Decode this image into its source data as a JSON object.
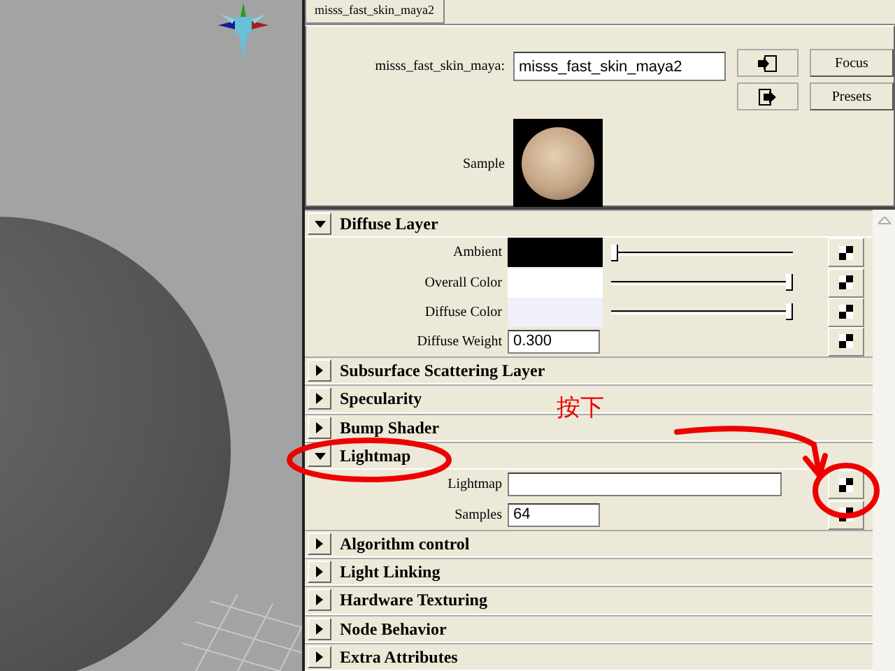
{
  "editor": {
    "tab": {
      "label": "misss_fast_skin_maya2",
      "selected": true
    },
    "name_label": "misss_fast_skin_maya:",
    "name_value": "misss_fast_skin_maya2",
    "buttons": [
      "Focus",
      "Presets"
    ],
    "sample_label": "Sample",
    "sections": [
      {
        "title": "Diffuse Layer",
        "expanded": true,
        "rows": [
          {
            "kind": "color",
            "label": "Ambient",
            "color": "#000000",
            "level": 0.0
          },
          {
            "kind": "color",
            "label": "Overall Color",
            "color": "#ffffff",
            "level": 1.0
          },
          {
            "kind": "color",
            "label": "Diffuse Color",
            "color": "#f0f0fa",
            "level": 1.0
          },
          {
            "kind": "number",
            "label": "Diffuse Weight",
            "value": "0.300"
          }
        ]
      },
      {
        "title": "Subsurface Scattering Layer",
        "expanded": false
      },
      {
        "title": "Specularity",
        "expanded": false
      },
      {
        "title": "Bump Shader",
        "expanded": false
      },
      {
        "title": "Lightmap",
        "expanded": true,
        "rows": [
          {
            "kind": "file",
            "label": "Lightmap",
            "value": ""
          },
          {
            "kind": "number",
            "label": "Samples",
            "value": "64"
          }
        ]
      },
      {
        "title": "Algorithm control",
        "expanded": false
      },
      {
        "title": "Light Linking",
        "expanded": false
      },
      {
        "title": "Hardware Texturing",
        "expanded": false
      },
      {
        "title": "Node Behavior",
        "expanded": false
      },
      {
        "title": "Extra Attributes",
        "expanded": false
      }
    ]
  },
  "annotation": {
    "text": "按下"
  }
}
